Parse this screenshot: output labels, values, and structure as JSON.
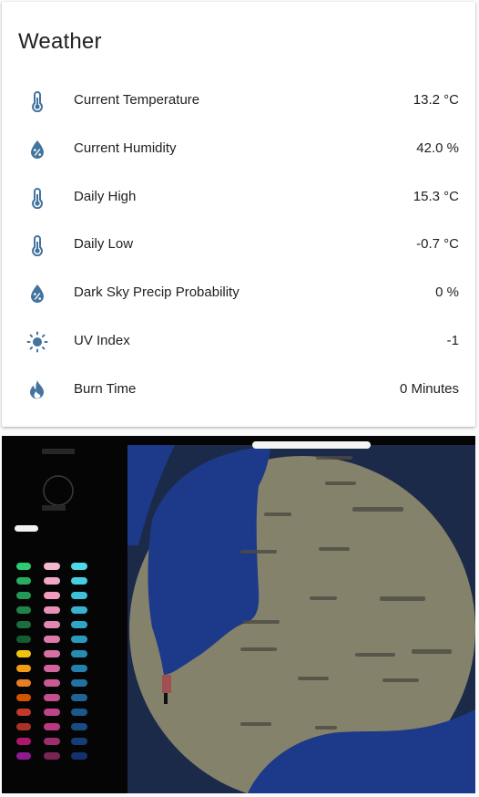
{
  "card": {
    "title": "Weather",
    "rows": [
      {
        "label": "Current Temperature",
        "value": "13.2 °C",
        "icon": "thermometer-icon"
      },
      {
        "label": "Current Humidity",
        "value": "42.0 %",
        "icon": "water-percent-icon"
      },
      {
        "label": "Daily High",
        "value": "15.3 °C",
        "icon": "thermometer-icon"
      },
      {
        "label": "Daily Low",
        "value": "-0.7 °C",
        "icon": "thermometer-icon"
      },
      {
        "label": "Dark Sky Precip Probability",
        "value": "0 %",
        "icon": "water-percent-icon"
      },
      {
        "label": "UV Index",
        "value": "-1",
        "icon": "sun-icon"
      },
      {
        "label": "Burn Time",
        "value": "0 Minutes",
        "icon": "fire-icon"
      }
    ]
  },
  "colors": {
    "icon": "#44739e",
    "text": "#212121",
    "lake": "#1d3a8a",
    "land": "#85826b"
  },
  "map": {
    "icon": "radar-map"
  }
}
